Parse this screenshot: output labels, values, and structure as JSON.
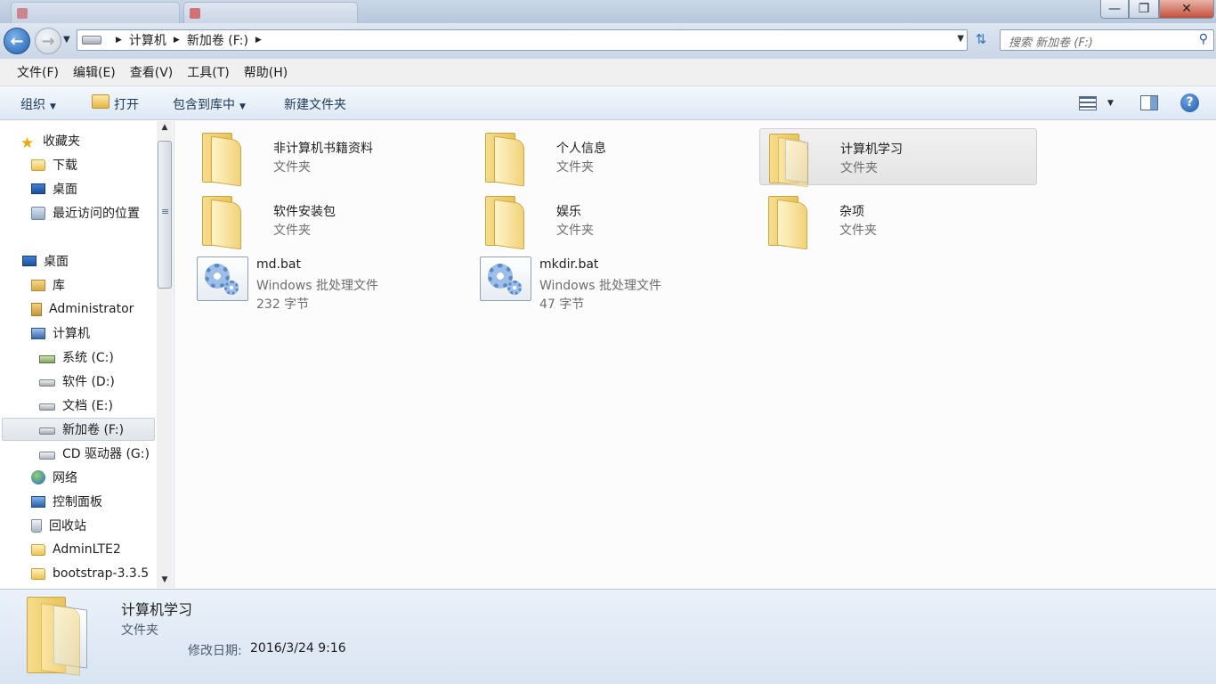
{
  "window": {
    "minimize_glyph": "—",
    "maximize_glyph": "❐",
    "close_glyph": "✕"
  },
  "nav": {
    "back_glyph": "←",
    "forward_glyph": "→",
    "breadcrumbs": [
      "计算机",
      "新加卷 (F:)"
    ],
    "search_placeholder": "搜索 新加卷 (F:)"
  },
  "menu": [
    "文件(F)",
    "编辑(E)",
    "查看(V)",
    "工具(T)",
    "帮助(H)"
  ],
  "toolbar": {
    "organize": "组织",
    "open": "打开",
    "include_in_library": "包含到库中",
    "new_folder": "新建文件夹",
    "help_glyph": "?"
  },
  "sidebar": {
    "items": [
      {
        "label": "收藏夹",
        "icon": "star-icon"
      },
      {
        "label": "下载",
        "icon": "download-folder-icon"
      },
      {
        "label": "桌面",
        "icon": "desktop-icon"
      },
      {
        "label": "最近访问的位置",
        "icon": "recent-places-icon"
      },
      {
        "label": "桌面",
        "icon": "desktop-icon"
      },
      {
        "label": "库",
        "icon": "library-icon"
      },
      {
        "label": "Administrator",
        "icon": "user-folder-icon"
      },
      {
        "label": "计算机",
        "icon": "computer-icon"
      },
      {
        "label": "系统 (C:)",
        "icon": "system-drive-icon"
      },
      {
        "label": "软件 (D:)",
        "icon": "drive-icon"
      },
      {
        "label": "文档 (E:)",
        "icon": "drive-icon"
      },
      {
        "label": "新加卷 (F:)",
        "icon": "drive-icon",
        "selected": true
      },
      {
        "label": "CD 驱动器 (G:)",
        "icon": "cd-drive-icon"
      },
      {
        "label": "网络",
        "icon": "network-icon"
      },
      {
        "label": "控制面板",
        "icon": "control-panel-icon"
      },
      {
        "label": "回收站",
        "icon": "recycle-bin-icon"
      },
      {
        "label": "AdminLTE2",
        "icon": "folder-icon"
      },
      {
        "label": "bootstrap-3.3.5",
        "icon": "folder-icon"
      }
    ]
  },
  "files": [
    {
      "name": "非计算机书籍资料",
      "type": "文件夹",
      "kind": "folder"
    },
    {
      "name": "个人信息",
      "type": "文件夹",
      "kind": "folder"
    },
    {
      "name": "计算机学习",
      "type": "文件夹",
      "kind": "folder",
      "selected": true
    },
    {
      "name": "软件安装包",
      "type": "文件夹",
      "kind": "folder"
    },
    {
      "name": "娱乐",
      "type": "文件夹",
      "kind": "folder"
    },
    {
      "name": "杂项",
      "type": "文件夹",
      "kind": "folder"
    },
    {
      "name": "md.bat",
      "type": "Windows 批处理文件",
      "size": "232 字节",
      "kind": "bat"
    },
    {
      "name": "mkdir.bat",
      "type": "Windows 批处理文件",
      "size": "47 字节",
      "kind": "bat"
    }
  ],
  "details": {
    "name": "计算机学习",
    "type": "文件夹",
    "modified_label": "修改日期:",
    "modified_value": "2016/3/24 9:16"
  }
}
